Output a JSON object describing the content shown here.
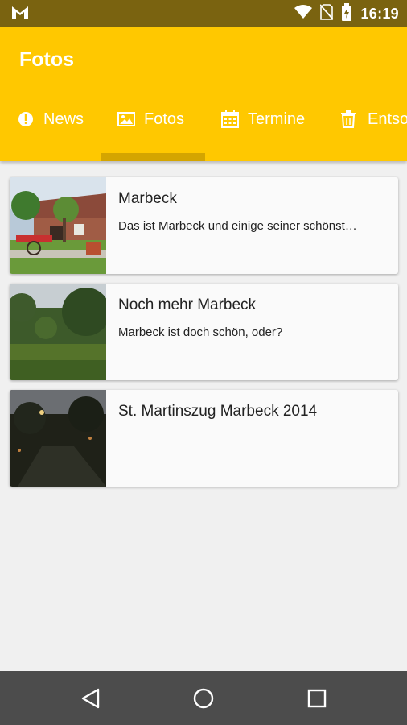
{
  "status_bar": {
    "time": "16:19",
    "icons": [
      "gmail-icon",
      "wifi-icon",
      "no-sim-icon",
      "battery-charging-icon"
    ]
  },
  "app_bar": {
    "title": "Fotos",
    "color": "#ffc800"
  },
  "tabs": [
    {
      "label": "News",
      "icon": "alert-circle-icon",
      "selected": false
    },
    {
      "label": "Fotos",
      "icon": "image-icon",
      "selected": true
    },
    {
      "label": "Termine",
      "icon": "calendar-icon",
      "selected": false
    },
    {
      "label": "Entso",
      "icon": "trash-icon",
      "selected": false
    }
  ],
  "albums": [
    {
      "title": "Marbeck",
      "description": "Das ist Marbeck und einige seiner schönst…"
    },
    {
      "title": "Noch mehr Marbeck",
      "description": "Marbeck ist doch schön, oder?"
    },
    {
      "title": "St. Martinszug Marbeck 2014",
      "description": ""
    }
  ],
  "nav_bar": {
    "buttons": [
      "back-icon",
      "home-icon",
      "recents-icon"
    ]
  }
}
